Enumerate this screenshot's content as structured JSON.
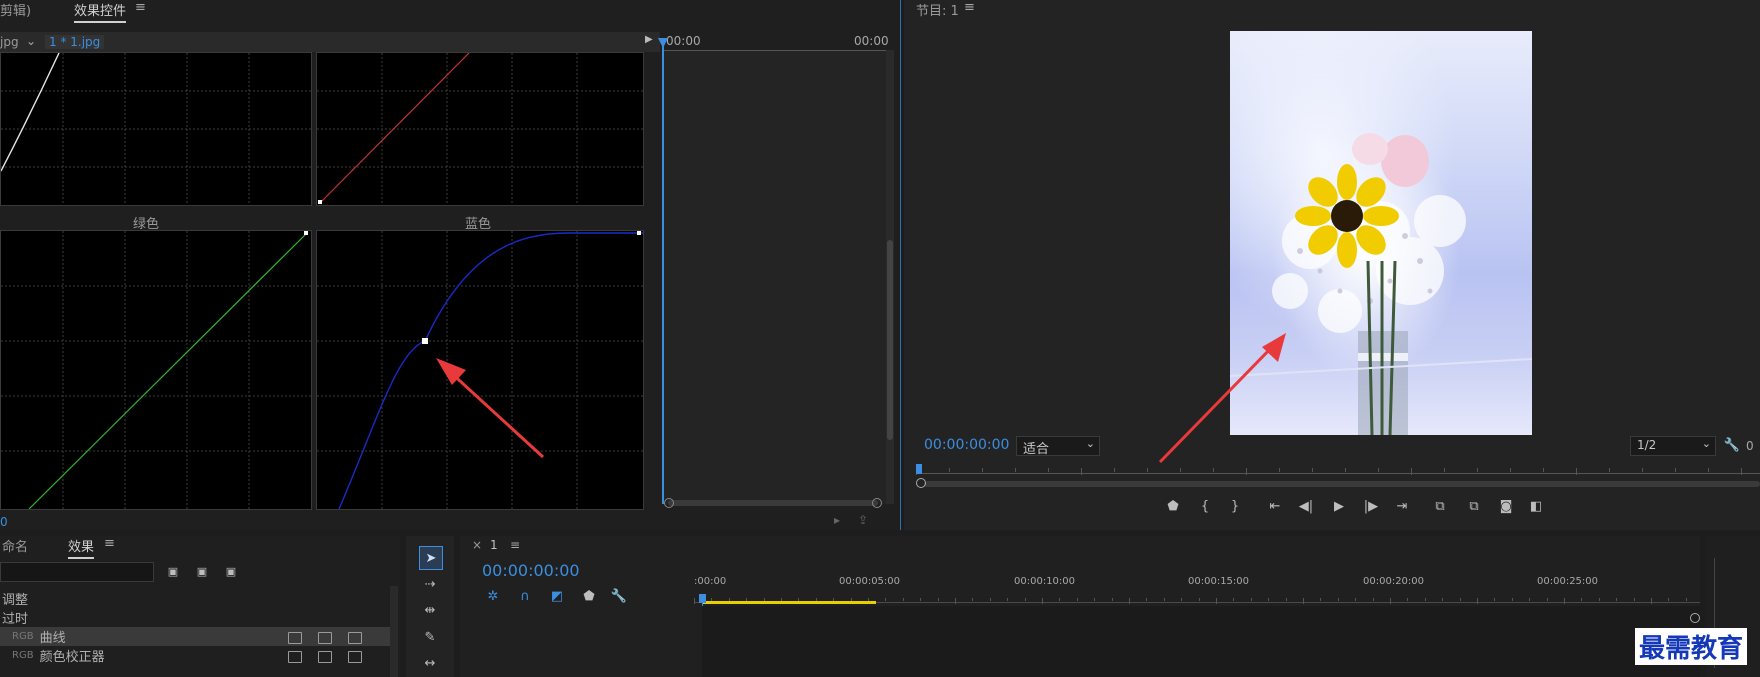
{
  "effect_controls": {
    "tab_prev": "剪辑)",
    "tab_active": "效果控件",
    "menu_glyph": "≡",
    "source_prev": "jpg",
    "source_label": "1 * 1.jpg",
    "timecode_left": "00:00",
    "timecode_right": "00:00",
    "curve_labels": {
      "green": "绿色",
      "blue": "蓝色"
    },
    "bottom_value": "0"
  },
  "program_monitor": {
    "title": "节目: 1",
    "menu_glyph": "≡",
    "timecode": "00:00:00:00",
    "fit_select": "适合",
    "resolution_select": "1/2",
    "edge_value": "0"
  },
  "effects_panel": {
    "tab_prev": "命名",
    "tab_active": "效果",
    "menu_glyph": "≡",
    "items": [
      {
        "prefix": "",
        "label": "调整"
      },
      {
        "prefix": "",
        "label": "过时"
      },
      {
        "prefix": "RGB",
        "label": "曲线"
      },
      {
        "prefix": "RGB",
        "label": "颜色校正器"
      }
    ]
  },
  "timeline": {
    "close_glyph": "×",
    "sequence": "1",
    "menu_glyph": "≡",
    "timecode": "00:00:00:00",
    "ruler_labels": [
      ":00:00",
      "00:00:05:00",
      "00:00:10:00",
      "00:00:15:00",
      "00:00:20:00",
      "00:00:25:00"
    ]
  },
  "watermark": "最需教育",
  "colors": {
    "accent": "#3b8ee0",
    "annotation_arrow": "#e83a3a",
    "curve_red": "#c83232",
    "curve_green": "#2eb82e",
    "curve_blue": "#1a2ac8",
    "playbar_yellow": "#e8d000"
  }
}
